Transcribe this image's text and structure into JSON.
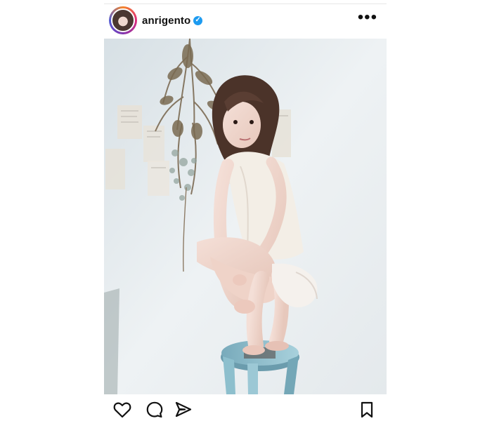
{
  "post": {
    "username": "anrigento",
    "verified": true,
    "verified_icon": "verified-badge",
    "more_icon": "more-horizontal-icon"
  },
  "actions": {
    "like_icon": "heart-icon",
    "comment_icon": "comment-icon",
    "share_icon": "send-icon",
    "save_icon": "bookmark-icon"
  },
  "colors": {
    "text": "#111111",
    "verified": "#1d9bf0",
    "avatar_ring_start": "#f58529",
    "avatar_ring_end": "#515bd4"
  }
}
